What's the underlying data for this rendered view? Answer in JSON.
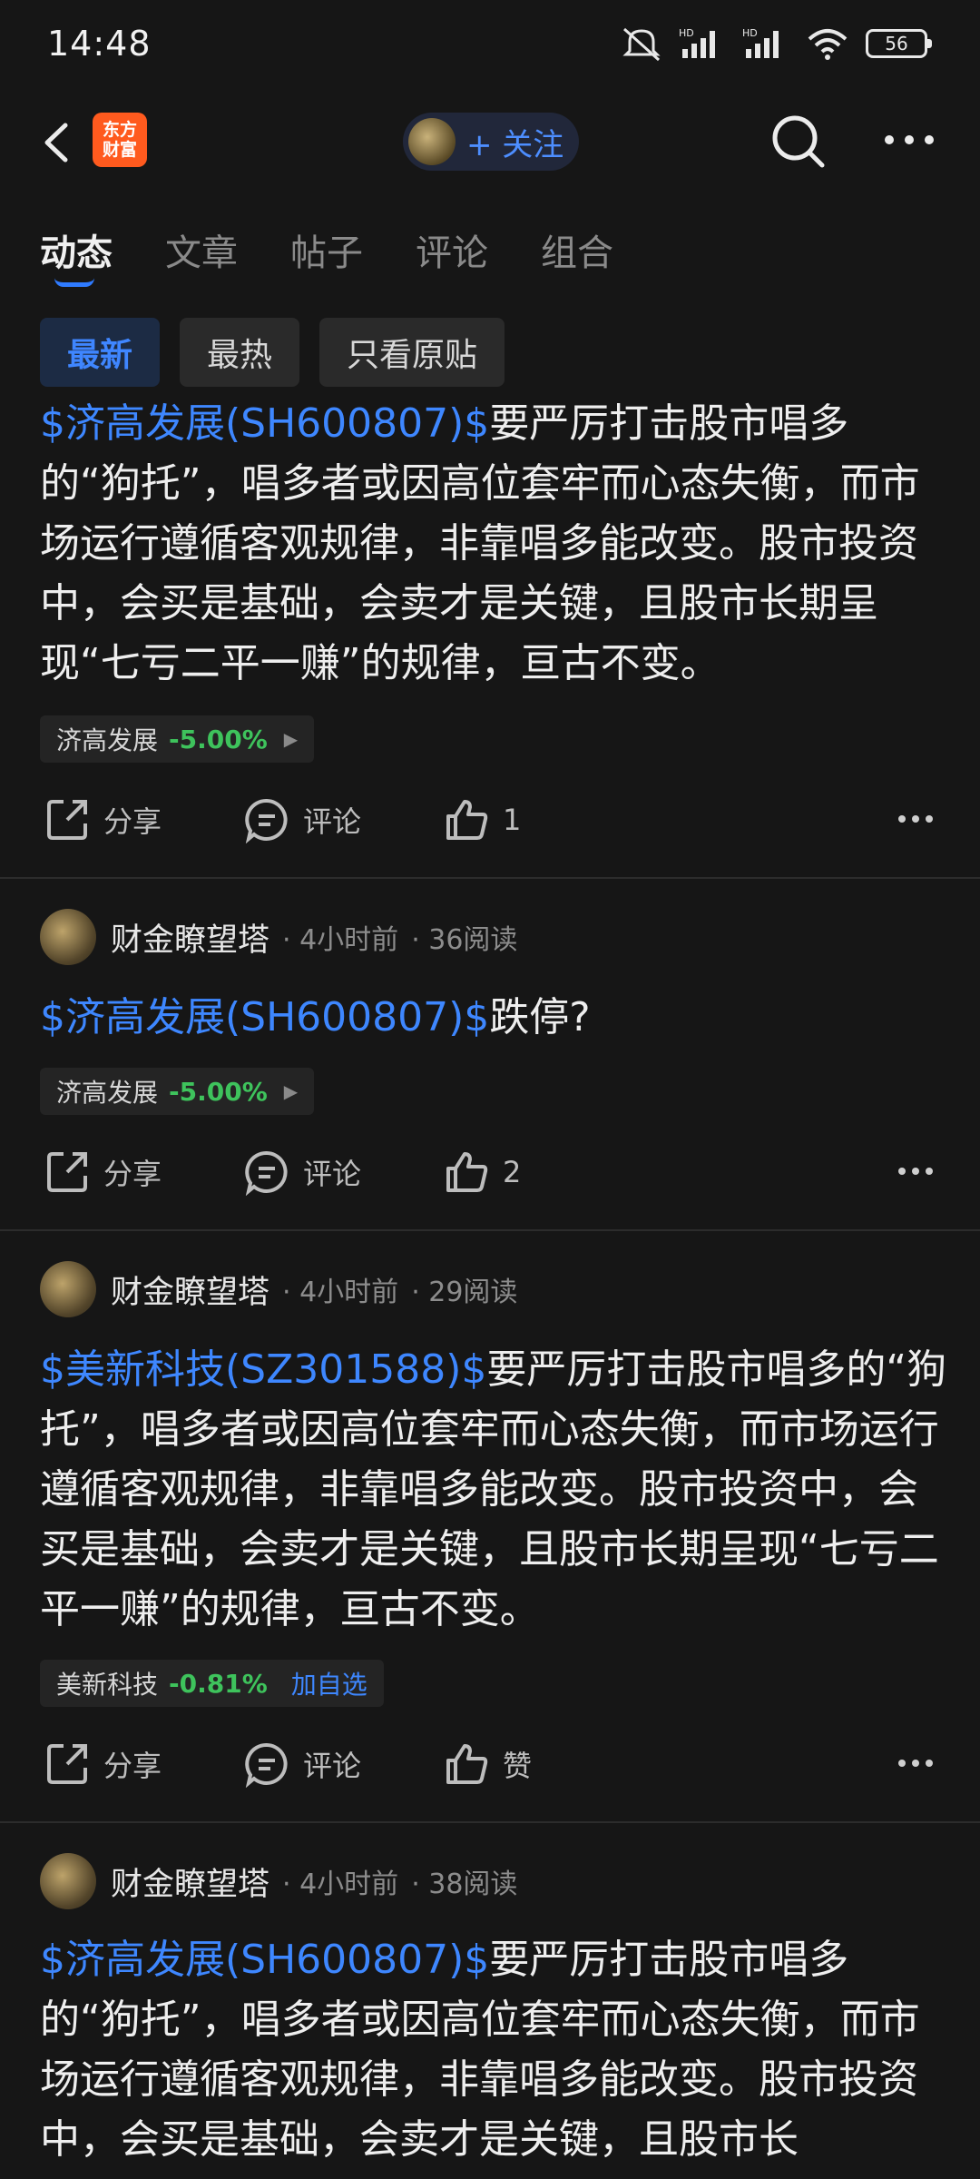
{
  "status": {
    "time": "14:48",
    "battery": "56"
  },
  "nav": {
    "logo_line1": "东方",
    "logo_line2": "财富",
    "follow_label": "+ 关注"
  },
  "tabs": [
    "动态",
    "文章",
    "帖子",
    "评论",
    "组合"
  ],
  "filters": [
    "最新",
    "最热",
    "只看原贴"
  ],
  "actions": {
    "share": "分享",
    "comment": "评论"
  },
  "posts": [
    {
      "stock_tag": "$济高发展(SH600807)$",
      "text": "要严厉打击股市唱多的“狗托”，唱多者或因高位套牢而心态失衡，而市场运行遵循客观规律，非靠唱多能改变。股市投资中，会买是基础，会卖才是关键，且股市长期呈现“七亏二平一赚”的规律，亘古不变。",
      "quote_name": "济高发展",
      "quote_change": "-5.00%",
      "likes": "1"
    },
    {
      "author": "财金瞭望塔",
      "time": "· 4小时前",
      "reads": "· 36阅读",
      "stock_tag": "$济高发展(SH600807)$",
      "text": "跌停?",
      "quote_name": "济高发展",
      "quote_change": "-5.00%",
      "likes": "2"
    },
    {
      "author": "财金瞭望塔",
      "time": "· 4小时前",
      "reads": "· 29阅读",
      "stock_tag": "$美新科技(SZ301588)$",
      "text": "要严厉打击股市唱多的“狗托”，唱多者或因高位套牢而心态失衡，而市场运行遵循客观规律，非靠唱多能改变。股市投资中，会买是基础，会卖才是关键，且股市长期呈现“七亏二平一赚”的规律，亘古不变。",
      "quote_name": "美新科技",
      "quote_change": "-0.81%",
      "quote_add": "加自选",
      "likes": "赞"
    },
    {
      "author": "财金瞭望塔",
      "time": "· 4小时前",
      "reads": "· 38阅读",
      "stock_tag": "$济高发展(SH600807)$",
      "text": "要严厉打击股市唱多的“狗托”，唱多者或因高位套牢而心态失衡，而市场运行遵循客观规律，非靠唱多能改变。股市投资中，会买是基础，会卖才是关键，且股市长"
    }
  ]
}
